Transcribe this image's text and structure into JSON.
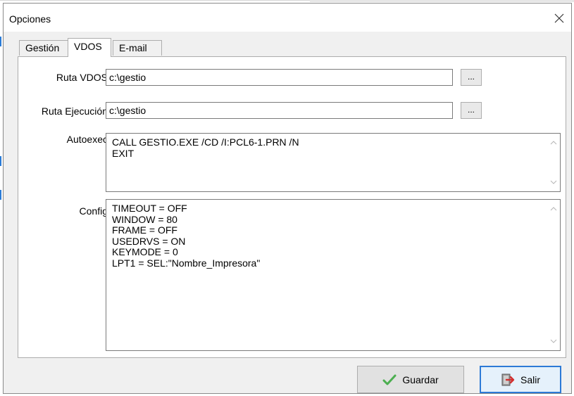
{
  "window": {
    "title": "Opciones"
  },
  "tabs": [
    {
      "label": "Gestión",
      "active": false
    },
    {
      "label": "VDOS",
      "active": true
    },
    {
      "label": "E-mail",
      "active": false
    }
  ],
  "vdos": {
    "ruta_vdos": {
      "label": "Ruta VDOS",
      "value": "c:\\gestio",
      "browse_label": "..."
    },
    "ruta_ejecucion": {
      "label": "Ruta Ejecución",
      "value": "c:\\gestio",
      "browse_label": "..."
    },
    "autoexec": {
      "label": "Autoexec",
      "text": "CALL GESTIO.EXE /CD /I:PCL6-1.PRN /N\nEXIT"
    },
    "config": {
      "label": "Config",
      "text": "TIMEOUT = OFF\nWINDOW = 80\nFRAME = OFF\nUSEDRVS = ON\nKEYMODE = 0\nLPT1 = SEL:\"Nombre_Impresora\""
    }
  },
  "buttons": {
    "guardar": {
      "label": "Guardar",
      "icon": "checkmark-icon",
      "color": "#4caf50"
    },
    "salir": {
      "label": "Salir",
      "icon": "exit-door-icon",
      "color": "#d32f2f"
    }
  },
  "colors": {
    "accent": "#2d7ad6"
  }
}
